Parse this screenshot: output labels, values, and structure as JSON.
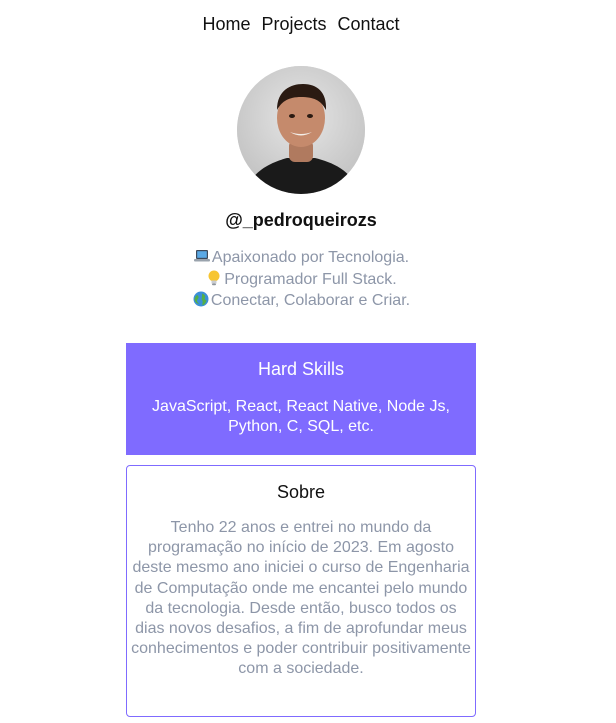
{
  "nav": {
    "items": [
      "Home",
      "Projects",
      "Contact"
    ]
  },
  "profile": {
    "avatar_alt": "profile photo",
    "username": "@_pedroqueirozs",
    "bio": [
      {
        "icon": "laptop-icon",
        "text": "Apaixonado por Tecnologia."
      },
      {
        "icon": "lightbulb-icon",
        "text": "Programador Full Stack."
      },
      {
        "icon": "globe-icon",
        "text": "Conectar, Colaborar e Criar."
      }
    ]
  },
  "skills": {
    "title": "Hard Skills",
    "text": "JavaScript, React, React Native, Node Js, Python, C, SQL, etc."
  },
  "about": {
    "title": "Sobre",
    "text": "Tenho 22 anos e entrei no mundo da programação no início de 2023. Em agosto deste mesmo ano iniciei o curso de Engenharia de Computação onde me encantei pelo mundo da tecnologia. Desde então, busco todos os dias novos desafios, a fim de aprofundar meus conhecimentos e poder contribuir positivamente com a sociedade."
  },
  "colors": {
    "accent": "#7f6bff",
    "muted_text": "#8d96a8",
    "text": "#111111"
  }
}
